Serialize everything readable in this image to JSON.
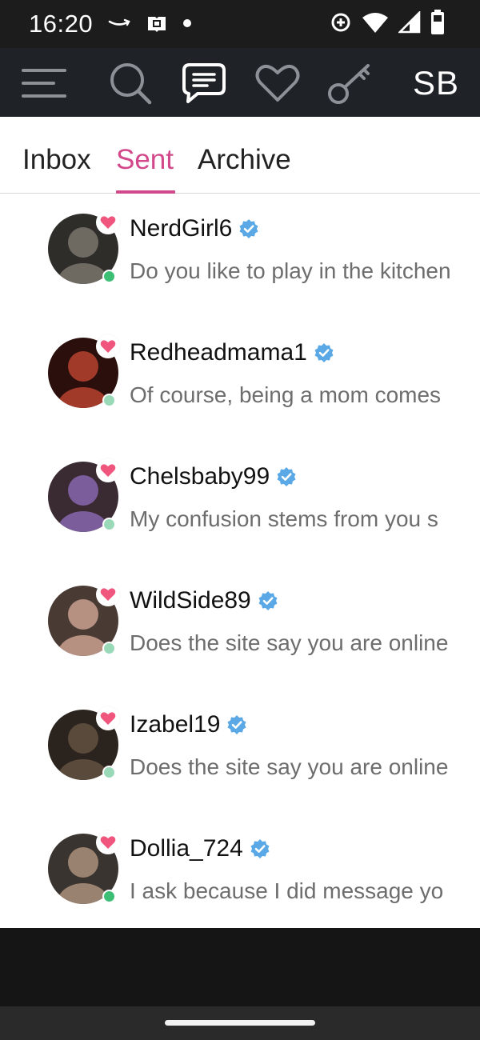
{
  "status_bar": {
    "time": "16:20",
    "left_icons": [
      "amazon-icon",
      "store-bag-icon",
      "notification-dot-icon"
    ],
    "right_icons": [
      "data-saver-icon",
      "wifi-icon",
      "signal-icon",
      "battery-icon"
    ]
  },
  "header": {
    "icons": [
      "menu-icon",
      "search-icon",
      "messages-icon",
      "favorites-icon",
      "key-icon"
    ],
    "active_icon": "messages-icon",
    "avatar_initials": "SB"
  },
  "tabs": [
    {
      "label": "Inbox",
      "active": false
    },
    {
      "label": "Sent",
      "active": true
    },
    {
      "label": "Archive",
      "active": false
    }
  ],
  "conversations": [
    {
      "name": "NerdGirl6",
      "preview": "Do you like to play in the kitchen",
      "verified": true,
      "online_color": "#3cbf74",
      "avatar_colors": [
        "#6e6a62",
        "#2e2d2a"
      ]
    },
    {
      "name": "Redheadmama1",
      "preview": "Of course, being a mom comes",
      "verified": true,
      "online_color": "#9ad9b8",
      "avatar_colors": [
        "#a23a2a",
        "#2a0f0c"
      ]
    },
    {
      "name": "Chelsbaby99",
      "preview": "My confusion stems from you s",
      "verified": true,
      "online_color": "#9ad9b8",
      "avatar_colors": [
        "#7a5d9a",
        "#3a2a32"
      ]
    },
    {
      "name": "WildSide89",
      "preview": "Does the site say you are online",
      "verified": true,
      "online_color": "#9ad9b8",
      "avatar_colors": [
        "#b69080",
        "#4a3a34"
      ]
    },
    {
      "name": "Izabel19",
      "preview": "Does the site say you are online",
      "verified": true,
      "online_color": "#9ad9b8",
      "avatar_colors": [
        "#5a4a3c",
        "#2b231d"
      ]
    },
    {
      "name": "Dollia_724",
      "preview": "I ask because I did message yo",
      "verified": true,
      "online_color": "#3cbf74",
      "avatar_colors": [
        "#9a8270",
        "#3a3430"
      ]
    }
  ],
  "colors": {
    "accent": "#d2488b",
    "heart": "#f0557d",
    "verified": "#5aa9e6",
    "header_bg": "#1f2328"
  }
}
